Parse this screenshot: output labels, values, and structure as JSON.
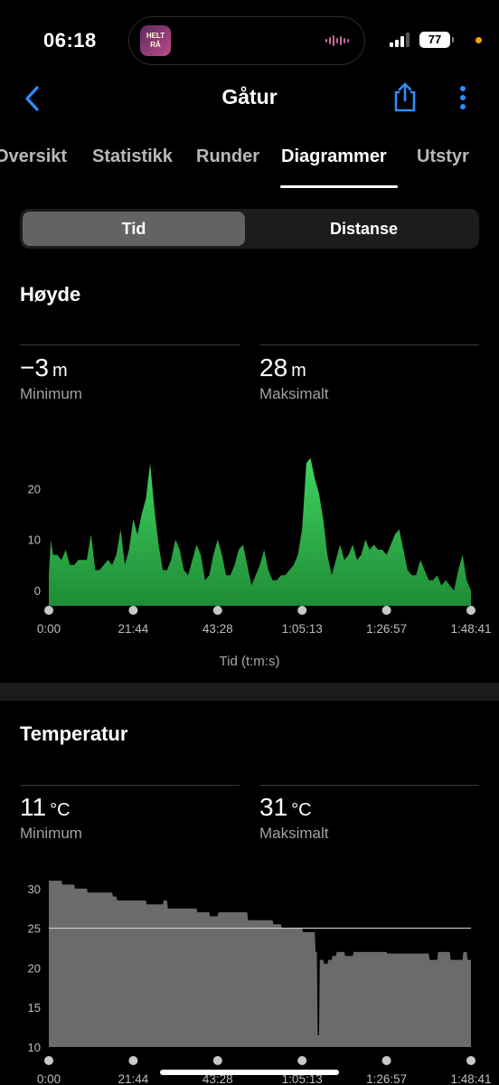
{
  "status": {
    "time": "06:18",
    "battery": "77",
    "island_art_text": "HELT RÅ"
  },
  "nav": {
    "title": "Gåtur"
  },
  "tabs": [
    {
      "label": "Oversikt"
    },
    {
      "label": "Statistikk"
    },
    {
      "label": "Runder"
    },
    {
      "label": "Diagrammer"
    },
    {
      "label": "Utstyr"
    }
  ],
  "segment": {
    "left": "Tid",
    "right": "Distanse"
  },
  "elevation": {
    "title": "Høyde",
    "min_value": "−3",
    "min_unit": "m",
    "min_label": "Minimum",
    "max_value": "28",
    "max_unit": "m",
    "max_label": "Maksimalt",
    "xlabel": "Tid (t:m:s)",
    "color": "#2fbf4f"
  },
  "temperature": {
    "title": "Temperatur",
    "min_value": "11",
    "min_unit": "°C",
    "min_label": "Minimum",
    "max_value": "31",
    "max_unit": "°C",
    "max_label": "Maksimalt",
    "color": "#6b6b6b"
  },
  "chart_data": [
    {
      "type": "area",
      "title": "Høyde",
      "xlabel": "Tid (t:m:s)",
      "ylabel": "",
      "x_ticks": [
        "0:00",
        "21:44",
        "43:28",
        "1:05:13",
        "1:26:57",
        "1:48:41"
      ],
      "y_ticks": [
        0,
        10,
        20
      ],
      "xlim": [
        0,
        100
      ],
      "ylim": [
        -3,
        30
      ],
      "x": [
        0,
        0.5,
        1,
        2,
        3,
        4,
        5,
        6,
        7,
        8,
        9,
        10,
        11,
        12,
        13,
        14,
        15,
        16,
        17,
        18,
        19,
        20,
        21,
        22,
        23,
        24,
        25,
        26,
        27,
        28,
        29,
        30,
        31,
        32,
        33,
        34,
        35,
        36,
        37,
        38,
        39,
        40,
        41,
        42,
        43,
        44,
        45,
        46,
        47,
        48,
        49,
        50,
        51,
        52,
        53,
        54,
        55,
        56,
        57,
        58,
        59,
        60,
        61,
        62,
        63,
        64,
        65,
        66,
        67,
        68,
        69,
        70,
        71,
        72,
        73,
        74,
        75,
        76,
        77,
        78,
        79,
        80,
        81,
        82,
        83,
        84,
        85,
        86,
        87,
        88,
        89,
        90,
        91,
        92,
        93,
        94,
        95,
        96,
        97,
        98,
        99,
        100
      ],
      "y": [
        3,
        10,
        7,
        7,
        6,
        8,
        5,
        5,
        6,
        6,
        6,
        11,
        4,
        4,
        5,
        6,
        5,
        7,
        12,
        5,
        8,
        14,
        11,
        15,
        18,
        25,
        16,
        9,
        4,
        4,
        6,
        10,
        8,
        4,
        3,
        6,
        9,
        7,
        2,
        3,
        7,
        10,
        7,
        3,
        3,
        5,
        8,
        9,
        5,
        1,
        3,
        5,
        8,
        4,
        2,
        2,
        3,
        3,
        4,
        5,
        7,
        12,
        25,
        26,
        22,
        19,
        14,
        7,
        3,
        6,
        9,
        6,
        7,
        9,
        6,
        7,
        10,
        8,
        9,
        8,
        8,
        7,
        9,
        11,
        12,
        8,
        4,
        3,
        3,
        6,
        4,
        2,
        2,
        3,
        1,
        2,
        1,
        0,
        4,
        7,
        2,
        0
      ],
      "series": [
        {
          "values_note": ""
        }
      ]
    },
    {
      "type": "area",
      "title": "Temperatur",
      "xlabel": "",
      "ylabel": "",
      "x_ticks": [
        "0:00",
        "21:44",
        "43:28",
        "1:05:13",
        "1:26:57",
        "1:48:41"
      ],
      "y_ticks": [
        10,
        15,
        20,
        25,
        30
      ],
      "xlim": [
        0,
        100
      ],
      "ylim": [
        10,
        31
      ],
      "reference_line": 25,
      "x": [
        0,
        3,
        3.2,
        6,
        6.2,
        9,
        9.2,
        15,
        15.2,
        16,
        16.2,
        23,
        23.2,
        27,
        27.2,
        28,
        28.2,
        35,
        35.2,
        38,
        38.2,
        40,
        40.2,
        47,
        47.2,
        53,
        53.2,
        55,
        55.2,
        60,
        60.2,
        63,
        63.2,
        63.5,
        63.7,
        64,
        64.2,
        65,
        65.2,
        66,
        66.2,
        67,
        67.2,
        68,
        68.2,
        70,
        70.2,
        72,
        72.2,
        80,
        80.2,
        90,
        90.2,
        92,
        92.2,
        95,
        95.2,
        98,
        98.2,
        99,
        99.2,
        100
      ],
      "y": [
        31,
        31,
        30.5,
        30.5,
        30,
        30,
        29.5,
        29.5,
        29,
        29,
        28.5,
        28.5,
        28,
        28,
        28.5,
        28.5,
        27.5,
        27.5,
        27,
        27,
        26.5,
        26.5,
        27,
        27,
        26,
        26,
        25.5,
        25.5,
        25,
        25,
        24.5,
        24.5,
        22,
        22,
        11.5,
        11.5,
        21,
        21,
        20.5,
        20.5,
        21,
        21,
        21.5,
        21.5,
        22,
        22,
        21.5,
        21.5,
        22,
        22,
        21.8,
        21.8,
        21,
        21,
        22,
        22,
        21,
        21,
        22,
        22,
        21,
        21
      ],
      "series": [
        {
          "values_note": ""
        }
      ]
    }
  ]
}
